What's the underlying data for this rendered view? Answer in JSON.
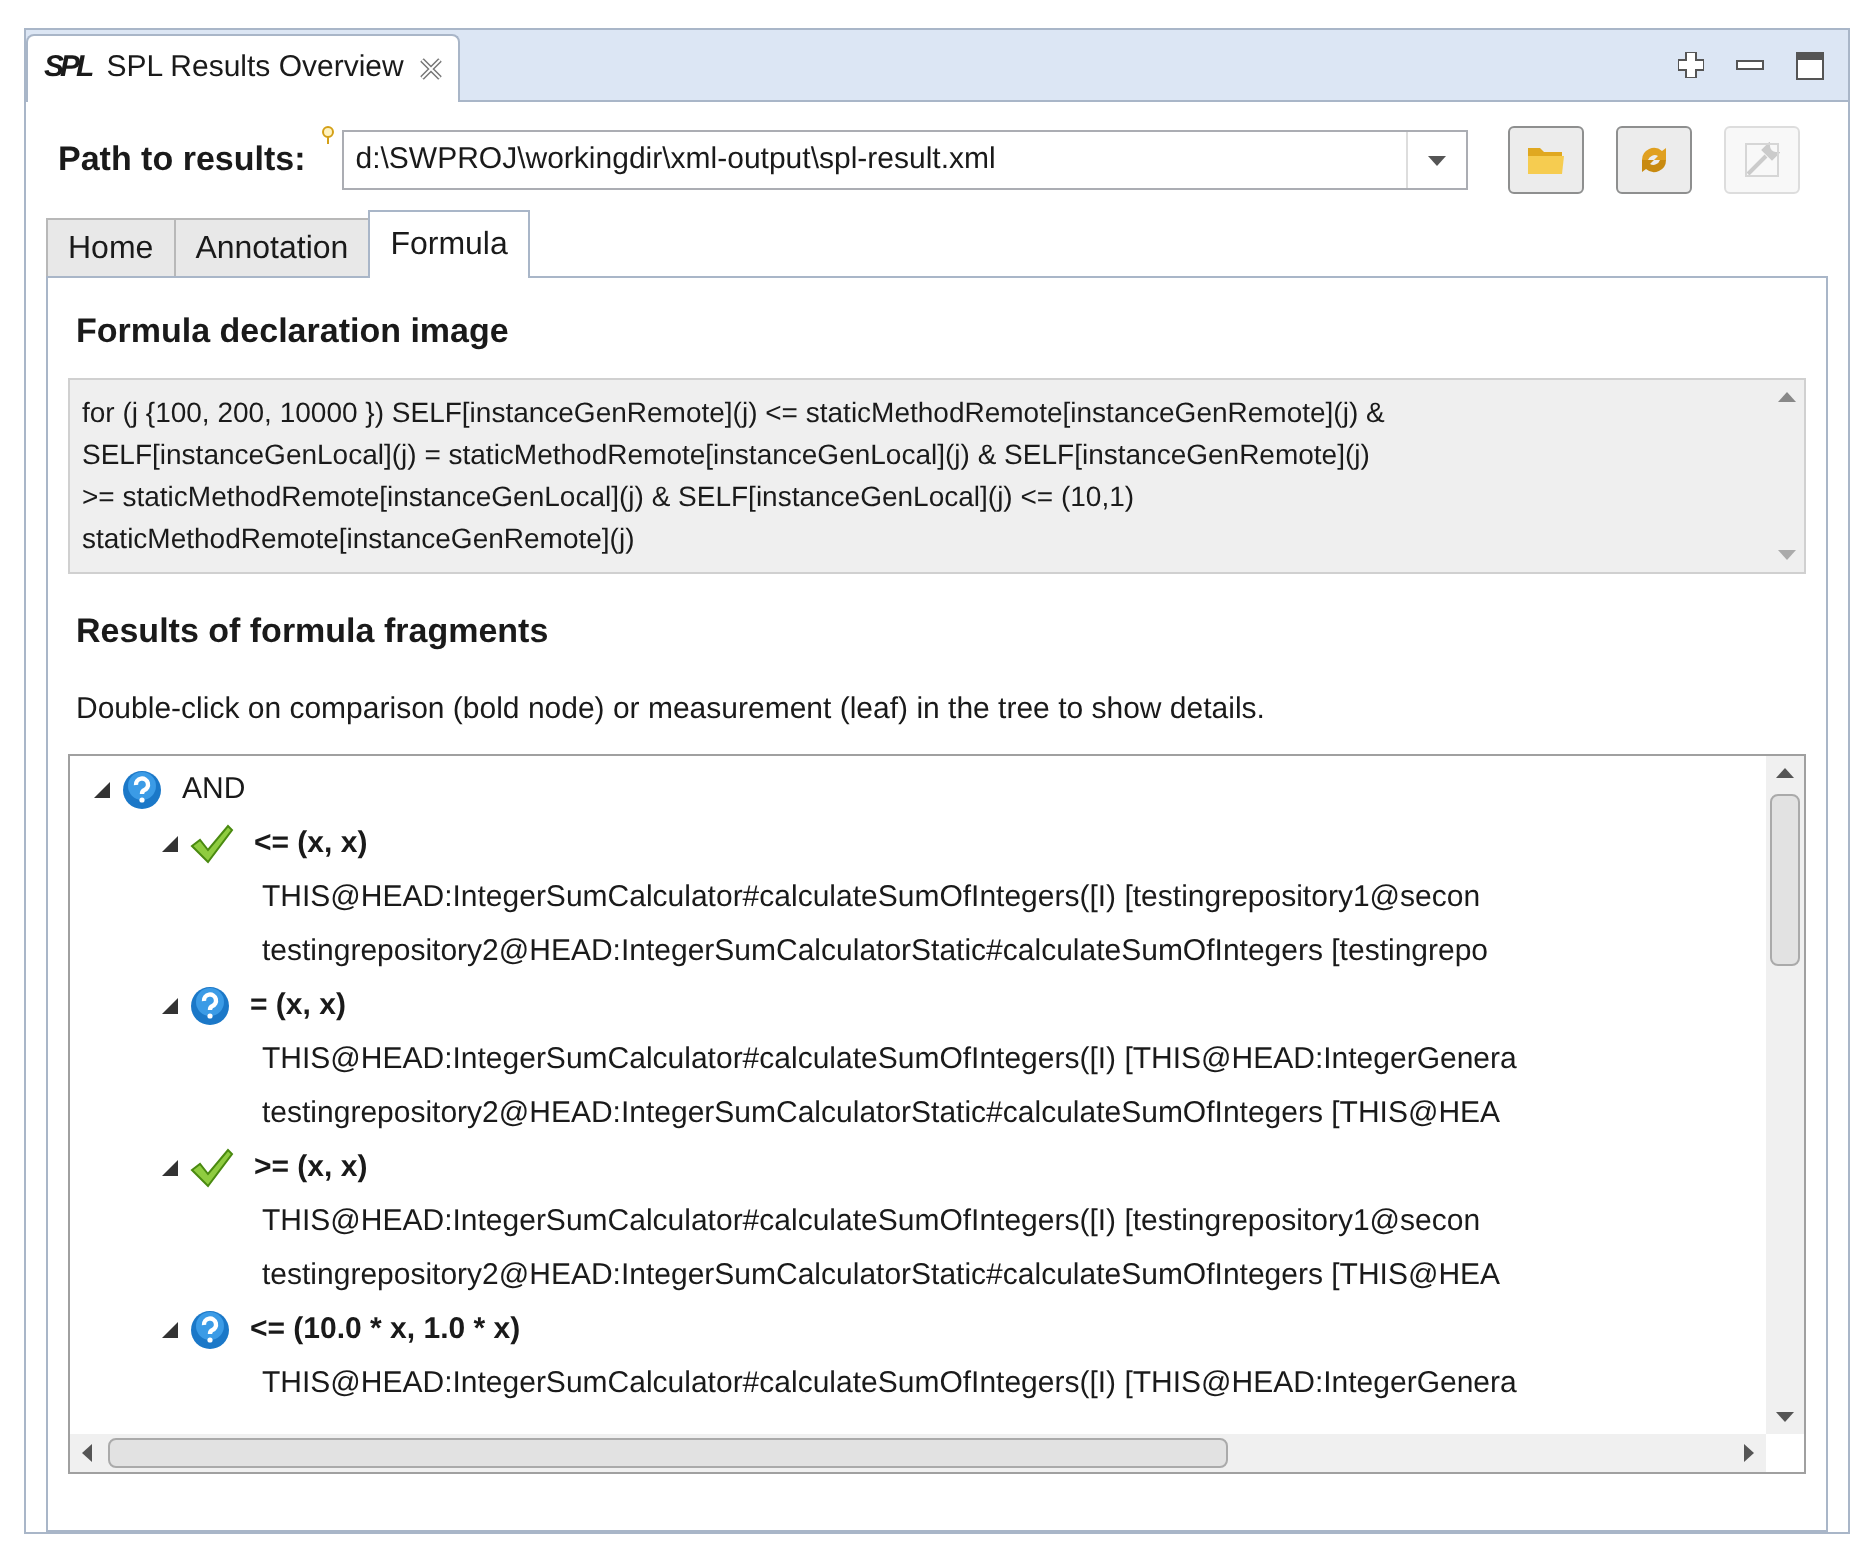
{
  "view_tab": {
    "title": "SPL Results Overview",
    "logo": "SPL"
  },
  "path": {
    "label": "Path to results:",
    "value": "d:\\SWPROJ\\workingdir\\xml-output\\spl-result.xml"
  },
  "tool_buttons": [
    {
      "kind": "folder",
      "disabled": false
    },
    {
      "kind": "refresh",
      "disabled": false
    },
    {
      "kind": "wrench",
      "disabled": true
    }
  ],
  "tabs": [
    {
      "label": "Home",
      "selected": false
    },
    {
      "label": "Annotation",
      "selected": false
    },
    {
      "label": "Formula",
      "selected": true
    }
  ],
  "declaration": {
    "heading": "Formula declaration image",
    "lines": [
      "for (j {100, 200, 10000 }) SELF[instanceGenRemote](j) <= staticMethodRemote[instanceGenRemote](j) &",
      "SELF[instanceGenLocal](j) = staticMethodRemote[instanceGenLocal](j) & SELF[instanceGenRemote](j)",
      ">= staticMethodRemote[instanceGenLocal](j) & SELF[instanceGenLocal](j) <= (10,1)",
      "staticMethodRemote[instanceGenRemote](j)"
    ]
  },
  "fragments": {
    "heading": "Results of formula fragments",
    "hint": "Double-click on comparison (bold node) or measurement (leaf) in the tree to show details.",
    "tree": [
      {
        "label": "AND",
        "kind": "unknown",
        "bold": false,
        "expanded": true,
        "children": [
          {
            "label": "<= (x, x)",
            "kind": "pass",
            "bold": true,
            "expanded": true,
            "children": [
              {
                "label": "THIS@HEAD:IntegerSumCalculator#calculateSumOfIntegers([I) [testingrepository1@secon"
              },
              {
                "label": "testingrepository2@HEAD:IntegerSumCalculatorStatic#calculateSumOfIntegers [testingrepo"
              }
            ]
          },
          {
            "label": "= (x, x)",
            "kind": "unknown",
            "bold": true,
            "expanded": true,
            "children": [
              {
                "label": "THIS@HEAD:IntegerSumCalculator#calculateSumOfIntegers([I) [THIS@HEAD:IntegerGenera"
              },
              {
                "label": "testingrepository2@HEAD:IntegerSumCalculatorStatic#calculateSumOfIntegers [THIS@HEA"
              }
            ]
          },
          {
            "label": ">= (x, x)",
            "kind": "pass",
            "bold": true,
            "expanded": true,
            "children": [
              {
                "label": "THIS@HEAD:IntegerSumCalculator#calculateSumOfIntegers([I) [testingrepository1@secon"
              },
              {
                "label": "testingrepository2@HEAD:IntegerSumCalculatorStatic#calculateSumOfIntegers [THIS@HEA"
              }
            ]
          },
          {
            "label": "<= (10.0 * x, 1.0 * x)",
            "kind": "unknown",
            "bold": true,
            "expanded": true,
            "children": [
              {
                "label": "THIS@HEAD:IntegerSumCalculator#calculateSumOfIntegers([I) [THIS@HEAD:IntegerGenera"
              }
            ]
          }
        ]
      }
    ]
  }
}
